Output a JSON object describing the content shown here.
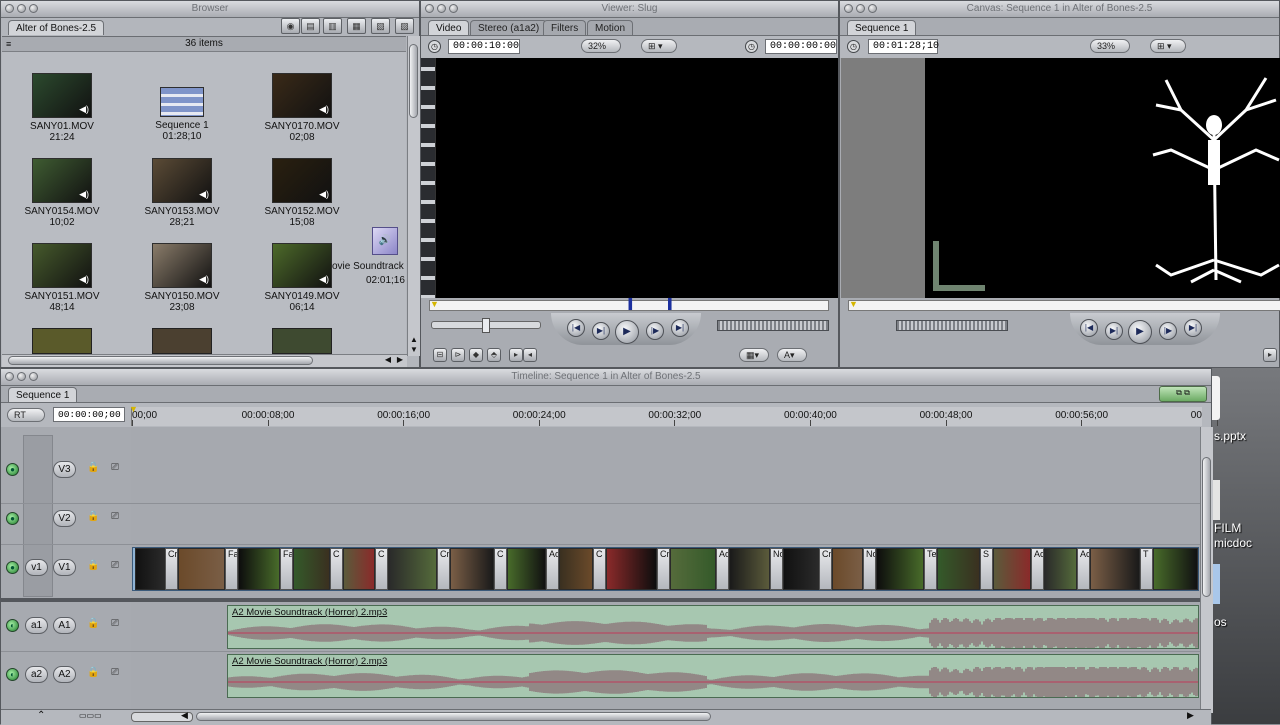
{
  "browser": {
    "title": "Browser",
    "tab": "Alter of Bones-2.5",
    "count": "36 items",
    "items": [
      {
        "name": "SANY01.MOV",
        "dur": "21:24",
        "color": "#2c4a2e"
      },
      {
        "name": "Sequence 1",
        "dur": "01:28;10",
        "color": "#c8ccd6"
      },
      {
        "name": "SANY0170.MOV",
        "dur": "02;08",
        "color": "#3a2a18"
      },
      {
        "name": "SANY0154.MOV",
        "dur": "10;02",
        "color": "#3f5c32"
      },
      {
        "name": "SANY0153.MOV",
        "dur": "28;21",
        "color": "#5b4b36"
      },
      {
        "name": "SANY0152.MOV",
        "dur": "15;08",
        "color": "#2a2010"
      },
      {
        "name": "SANY0151.MOV",
        "dur": "48;14",
        "color": "#465a2c"
      },
      {
        "name": "SANY0150.MOV",
        "dur": "23;08",
        "color": "#8a7c6a"
      },
      {
        "name": "SANY0149.MOV",
        "dur": "06;14",
        "color": "#4d6a2a"
      }
    ],
    "audio_item": {
      "name": "ovie Soundtrack (l",
      "dur": "02:01;16"
    }
  },
  "viewer": {
    "title": "Viewer: Slug",
    "tabs": [
      "Video",
      "Stereo (a1a2)",
      "Filters",
      "Motion"
    ],
    "duration": "00:00:10:00",
    "zoom": "32%",
    "current": "00:00:00:00"
  },
  "canvas": {
    "title": "Canvas: Sequence 1 in Alter of Bones-2.5",
    "tab": "Sequence 1",
    "duration": "00:01:28;10",
    "zoom": "33%"
  },
  "timeline": {
    "title": "Timeline: Sequence 1 in Alter of Bones-2.5",
    "tab": "Sequence 1",
    "rt": "RT",
    "current": "00:00:00;00",
    "ruler": [
      "00;00",
      "00:00:08;00",
      "00:00:16;00",
      "00:00:24;00",
      "00:00:32;00",
      "00:00:40;00",
      "00:00:48;00",
      "00:00:56;00",
      "00"
    ],
    "video_tracks": [
      {
        "src": "",
        "dst": "V3"
      },
      {
        "src": "",
        "dst": "V2"
      },
      {
        "src": "v1",
        "dst": "V1"
      }
    ],
    "audio_tracks": [
      {
        "src": "a1",
        "dst": "A1",
        "clip": "A2 Movie Soundtrack (Horror) 2.mp3"
      },
      {
        "src": "a2",
        "dst": "A2",
        "clip": "A2 Movie Soundtrack (Horror) 2.mp3"
      }
    ],
    "clip_labels": [
      "Cr",
      "Fa",
      "Fa",
      "C",
      "C",
      "Cr",
      "C",
      "Ac",
      "C",
      "Cr",
      "Ac",
      "Nc",
      "Cr",
      "Nc",
      "Te",
      "S",
      "Ac",
      "Ac",
      "T",
      "Cr",
      "Ac",
      "Cr"
    ]
  },
  "desktop": {
    "file1": "s.pptx",
    "file2_line1": "FILM",
    "file2_line2": "micdoc",
    "file3": "os"
  }
}
